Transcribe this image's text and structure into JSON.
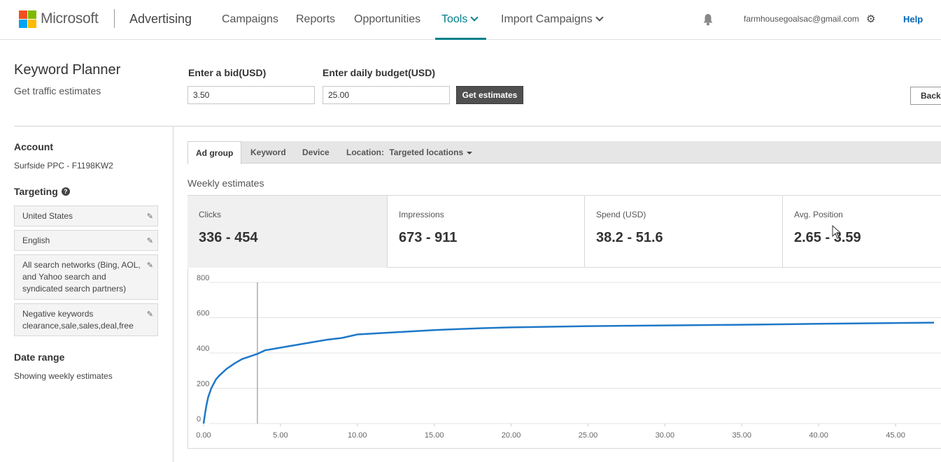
{
  "topnav": {
    "brand": "Microsoft",
    "product": "Advertising",
    "items": [
      {
        "label": "Campaigns"
      },
      {
        "label": "Reports"
      },
      {
        "label": "Opportunities"
      },
      {
        "label": "Tools"
      },
      {
        "label": "Import Campaigns"
      }
    ],
    "active_item": "Tools",
    "email": "farmhousegoalsac@gmail.com",
    "help": "Help",
    "icons": [
      "bell-icon",
      "gear-icon",
      "chevron-down-icon"
    ],
    "accent_color": "#00808b"
  },
  "header": {
    "title": "Keyword Planner",
    "subtitle": "Get traffic estimates",
    "bid_label": "Enter a bid(USD)",
    "bid_value": "3.50",
    "budget_label": "Enter daily budget(USD)",
    "budget_value": "25.00",
    "get_estimates": "Get estimates",
    "back_button": "Back t"
  },
  "sidebar": {
    "account_heading": "Account",
    "account_value": "Surfside PPC - F1198KW2",
    "targeting_heading": "Targeting",
    "targeting_items": [
      {
        "text": "United States"
      },
      {
        "text": "English"
      },
      {
        "text": "All search networks (Bing, AOL, and Yahoo search and syndicated search partners)"
      },
      {
        "text": "Negative keywords clearance,sale,sales,deal,free"
      }
    ],
    "date_heading": "Date range",
    "date_value": "Showing weekly estimates"
  },
  "tabs": {
    "items": [
      {
        "label": "Ad group"
      },
      {
        "label": "Keyword"
      },
      {
        "label": "Device"
      }
    ],
    "active": "Ad group",
    "location_label": "Location:",
    "location_value": "Targeted locations"
  },
  "estimates": {
    "heading": "Weekly estimates",
    "metrics": [
      {
        "label": "Clicks",
        "value": "336 - 454"
      },
      {
        "label": "Impressions",
        "value": "673 - 911"
      },
      {
        "label": "Spend (USD)",
        "value": "38.2 - 51.6"
      },
      {
        "label": "Avg. Position",
        "value": "2.65 - 3.59"
      }
    ]
  },
  "chart_data": {
    "type": "line",
    "title": "",
    "xlabel": "",
    "ylabel": "",
    "xlim": [
      -1,
      48
    ],
    "ylim": [
      0,
      800
    ],
    "yticks": [
      "0",
      "200",
      "400",
      "600",
      "800"
    ],
    "xticks": [
      "0.00",
      "5.00",
      "10.00",
      "15.00",
      "20.00",
      "25.00",
      "30.00",
      "35.00",
      "40.00",
      "45.00"
    ],
    "xtick_values": [
      0,
      5,
      10,
      15,
      20,
      25,
      30,
      35,
      40,
      45
    ],
    "selected_bid": 3.5,
    "line_color": "#1e78c8",
    "grid": true,
    "series": [
      {
        "x": [
          0,
          0.1,
          0.2,
          0.3,
          0.5,
          0.8,
          1.0,
          1.5,
          2.0,
          2.5,
          3.0,
          3.5,
          4.0,
          5.0,
          6.0,
          7.0,
          8.0,
          9.0,
          10.0,
          12.0,
          15.0,
          18.0,
          20.0,
          25.0,
          30.0,
          35.0,
          40.0,
          45.0,
          47.5
        ],
        "y": [
          0,
          60,
          110,
          150,
          200,
          250,
          270,
          310,
          340,
          365,
          380,
          395,
          415,
          430,
          445,
          460,
          475,
          485,
          505,
          515,
          530,
          540,
          545,
          552,
          556,
          560,
          565,
          570,
          572
        ]
      }
    ]
  }
}
